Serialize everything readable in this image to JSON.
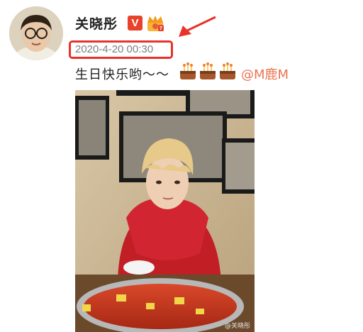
{
  "post": {
    "username": "关晓彤",
    "verified_badge": "V",
    "timestamp": "2020-4-20 00:30",
    "text": "生日快乐哟～～",
    "mention": "@M鹿M",
    "watermark": "@关晓彤"
  },
  "icons": {
    "verified": "verified-v-icon",
    "member_crown": "crown-badge-icon",
    "cake": "birthday-cake-icon"
  },
  "colors": {
    "highlight": "#e8322a",
    "mention": "#eb7350",
    "verified": "#e8432a"
  }
}
